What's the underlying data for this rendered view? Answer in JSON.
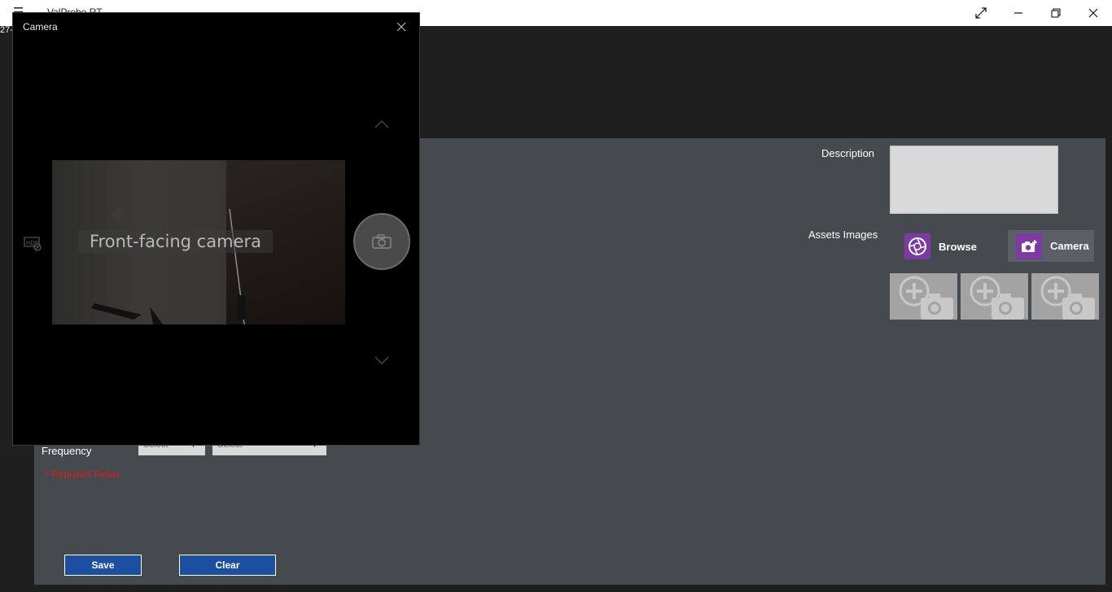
{
  "app": {
    "title": "ValProbe RT",
    "left_fragment": "27-"
  },
  "window_controls": {
    "fullscreen_icon": "expand-icon",
    "minimize_icon": "minimize-icon",
    "restore_icon": "restore-icon",
    "close_icon": "close-icon"
  },
  "form": {
    "description_label": "Description",
    "assets_images_label": "Assets Images",
    "browse_label": "Browse",
    "camera_label": "Camera",
    "frequency_label": "Frequency",
    "frequency_select_1": "Select",
    "frequency_select_2": "Select",
    "required_note": "* Required Fields",
    "save_label": "Save",
    "clear_label": "Clear",
    "thumbnails": [
      "add-photo-icon",
      "add-photo-icon",
      "add-photo-icon"
    ]
  },
  "camera_dialog": {
    "title": "Camera",
    "preview_label": "Front-facing camera"
  },
  "colors": {
    "accent_purple": "#7d3aa3",
    "panel_bg": "#454a4e",
    "button_blue": "#1c4fa2",
    "required_red": "#e01d1d"
  }
}
